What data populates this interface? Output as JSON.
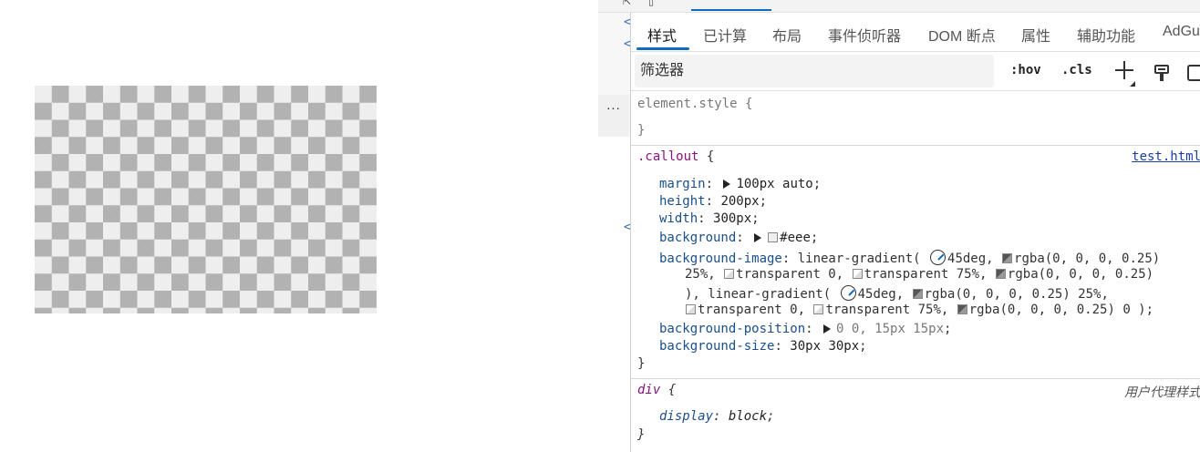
{
  "preview": {
    "callout_colors": {
      "background": "#eeeeee",
      "checker": "rgba(0, 0, 0, 0.25)"
    }
  },
  "devtools": {
    "tabs": [
      {
        "label": "样式",
        "active": true
      },
      {
        "label": "已计算"
      },
      {
        "label": "布局"
      },
      {
        "label": "事件侦听器"
      },
      {
        "label": "DOM 断点"
      },
      {
        "label": "属性"
      },
      {
        "label": "辅助功能"
      },
      {
        "label": "AdGu"
      }
    ],
    "filter": {
      "placeholder": "筛选器"
    },
    "toolbar": {
      "hov": ":hov",
      "cls": ".cls",
      "more": "..."
    },
    "rules": {
      "element_style": {
        "selector": "element.style",
        "open": "{",
        "close": "}"
      },
      "callout": {
        "selector": ".callout",
        "open": "{",
        "close": "}",
        "source": "test.html",
        "props": {
          "margin": {
            "name": "margin",
            "value": "100px auto"
          },
          "height": {
            "name": "height",
            "value": "200px"
          },
          "width": {
            "name": "width",
            "value": "300px"
          },
          "background": {
            "name": "background",
            "value": "#eee"
          },
          "background_image": {
            "name": "background-image",
            "parts": {
              "fn1": "linear-gradient(",
              "angle1": "45deg,",
              "rgba": "rgba(0, 0, 0, 0.25)",
              "pct25": "25%,",
              "transparent0": "transparent 0,",
              "transparent75": "transparent 75%,",
              "rgba_zero": "rgba(0, 0, 0, 0.25)",
              "close_comma": "), linear-gradient(",
              "angle2": "45deg,",
              "rgba_2": "rgba(0, 0, 0, 0.25) 25%,",
              "end": "rgba(0, 0, 0, 0.25) 0 );"
            }
          },
          "background_position": {
            "name": "background-position",
            "value": "0 0, 15px 15px"
          },
          "background_size": {
            "name": "background-size",
            "value": "30px 30px"
          }
        }
      },
      "div": {
        "selector": "div",
        "open": "{",
        "close": "}",
        "source": "用户代理样式",
        "props": {
          "display": {
            "name": "display",
            "value": "block"
          }
        }
      }
    }
  }
}
